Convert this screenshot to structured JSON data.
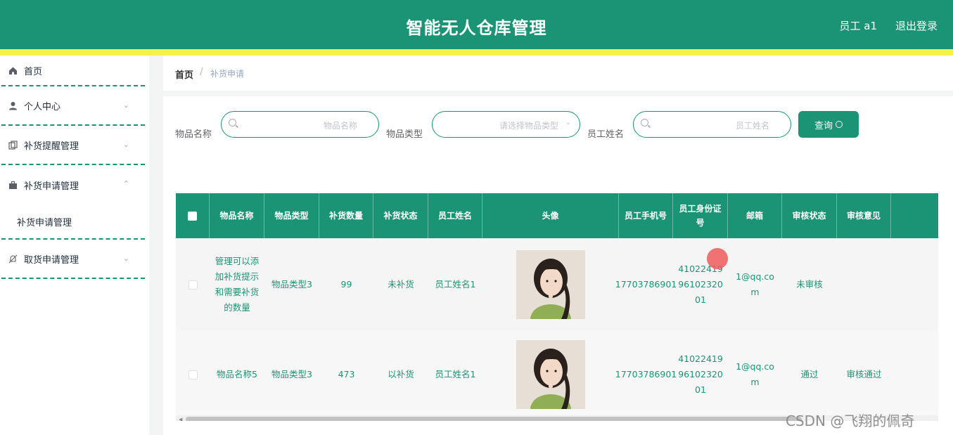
{
  "app": {
    "title": "智能无人仓库管理",
    "user": "员工 a1",
    "logout": "退出登录"
  },
  "sidebar": {
    "items": [
      {
        "label": "首页",
        "icon": "home-icon"
      },
      {
        "label": "个人中心",
        "icon": "user-icon"
      },
      {
        "label": "补货提醒管理",
        "icon": "copy-icon"
      },
      {
        "label": "补货申请管理",
        "icon": "briefcase-icon"
      },
      {
        "label": "补货申请管理"
      },
      {
        "label": "取货申请管理",
        "icon": "bell-off-icon"
      }
    ]
  },
  "breadcrumb": {
    "home": "首页",
    "sep": "/",
    "current": "补货申请"
  },
  "search": {
    "name_label": "物品名称",
    "name_placeholder": "物品名称",
    "type_label": "物品类型",
    "type_placeholder": "请选择物品类型",
    "emp_label": "员工姓名",
    "emp_placeholder": "员工姓名",
    "query_label": "查询"
  },
  "table": {
    "headers": [
      "物品名称",
      "物品类型",
      "补货数量",
      "补货状态",
      "员工姓名",
      "头像",
      "员工手机号",
      "员工身份证号",
      "邮箱",
      "审核状态",
      "审核意见"
    ],
    "rows": [
      {
        "name": "管理可以添加补货提示 和需要补货的数量",
        "type": "物品类型3",
        "qty": "99",
        "status": "未补货",
        "emp": "员工姓名1",
        "phone": "17703786901",
        "idcard": "410224199610232001",
        "email": "1@qq.com",
        "audit": "未审核",
        "opinion": ""
      },
      {
        "name": "物品名称5",
        "type": "物品类型3",
        "qty": "473",
        "status": "以补货",
        "emp": "员工姓名1",
        "phone": "17703786901",
        "idcard": "410224199610232001",
        "email": "1@qq.com",
        "audit": "通过",
        "opinion": "审核通过"
      }
    ]
  },
  "watermark": "CSDN @飞翔的佩奇",
  "colors": {
    "primary": "#1a9474",
    "accent_bar": "#f5f04a"
  }
}
